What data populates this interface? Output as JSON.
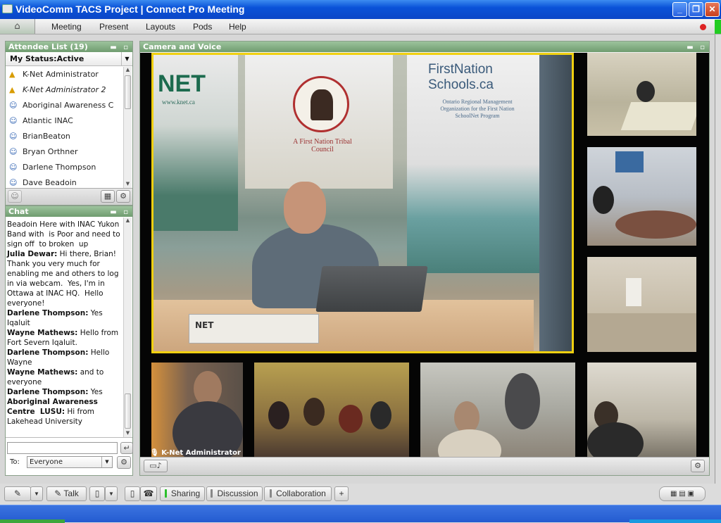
{
  "window": {
    "title": "VideoComm TACS Project  | Connect Pro Meeting",
    "minimize": "_",
    "restore": "❐",
    "close": "✕"
  },
  "menu": {
    "items": [
      "Meeting",
      "Present",
      "Layouts",
      "Pods",
      "Help"
    ]
  },
  "attendee_pod": {
    "title": "Attendee List (19)",
    "my_status": "My Status:Active",
    "attendees": [
      {
        "name": "K-Net Administrator",
        "role": "host"
      },
      {
        "name": "K-Net Administrator 2",
        "role": "host"
      },
      {
        "name": "Aboriginal Awareness C",
        "role": "participant"
      },
      {
        "name": "Atlantic INAC",
        "role": "participant"
      },
      {
        "name": "BrianBeaton",
        "role": "participant"
      },
      {
        "name": "Bryan Orthner",
        "role": "participant"
      },
      {
        "name": "Darlene Thompson",
        "role": "participant"
      },
      {
        "name": "Dave Beadoin",
        "role": "participant"
      }
    ]
  },
  "chat_pod": {
    "title": "Chat",
    "messages": [
      {
        "sender": "",
        "text": "Beadoin Here with INAC Yukon  Band with  is Poor and need to sign off  to broken  up"
      },
      {
        "sender": "Julia Dewar:",
        "text": " Hi there, Brian! Thank you very much for enabling me and others to log in via webcam.  Yes, I'm in Ottawa at INAC HQ.  Hello everyone!"
      },
      {
        "sender": "Darlene Thompson:",
        "text": " Yes Iqaluit"
      },
      {
        "sender": "Wayne Mathews:",
        "text": " Hello from Fort Severn Iqaluit."
      },
      {
        "sender": "Darlene Thompson:",
        "text": " Hello Wayne"
      },
      {
        "sender": "Wayne Mathews:",
        "text": " and to everyone"
      },
      {
        "sender": "Darlene Thompson:",
        "text": " Yes"
      },
      {
        "sender": "Aboriginal Awareness Centre  LUSU:",
        "text": " Hi from Lakehead University"
      }
    ],
    "input_value": "",
    "to_label": "To:",
    "to_value": "Everyone"
  },
  "camera_pod": {
    "title": "Camera and Voice",
    "speaker_label": "K-Net Administrator",
    "main_tile": {
      "banner_left": "NET",
      "banner_left_sub": "www.knet.ca",
      "banner_mid": "A First Nation Tribal Council",
      "banner_right": "FirstNation Schools.ca",
      "banner_right_sub": "Ontario Regional Management Organization for the First Nation SchoolNet Program",
      "card": "NET"
    }
  },
  "bottom_toolbar": {
    "talk": "Talk",
    "tabs": [
      {
        "label": "Sharing",
        "active": true
      },
      {
        "label": "Discussion",
        "active": false
      },
      {
        "label": "Collaboration",
        "active": false
      }
    ],
    "add": "+"
  },
  "colors": {
    "pod_header": "#7fa87f",
    "active_speaker": "#f0d010",
    "title_bar": "#0a52d8"
  }
}
